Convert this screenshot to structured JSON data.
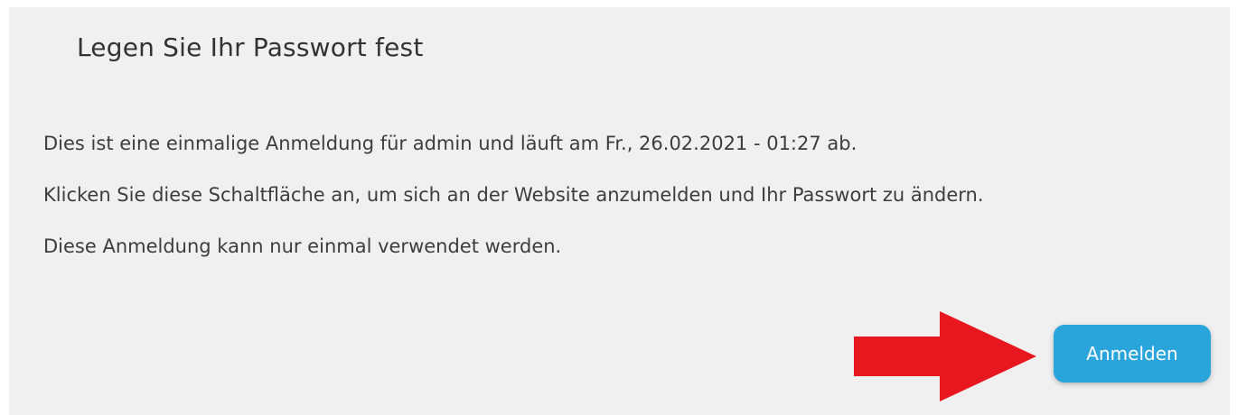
{
  "dialog": {
    "title": "Legen Sie Ihr Passwort fest",
    "paragraphs": [
      "Dies ist eine einmalige Anmeldung für admin und läuft am Fr., 26.02.2021 - 01:27 ab.",
      "Klicken Sie diese Schaltfläche an, um sich an der Website anzumelden und Ihr Passwort zu ändern.",
      "Diese Anmeldung kann nur einmal verwendet werden."
    ],
    "login_button_label": "Anmelden"
  },
  "annotation": {
    "arrow_icon": "right-arrow-icon",
    "arrow_color": "#e8171f"
  },
  "colors": {
    "panel_background": "#f0f0f0",
    "button_background": "#2aa5dc",
    "text": "#3d3d3d"
  }
}
